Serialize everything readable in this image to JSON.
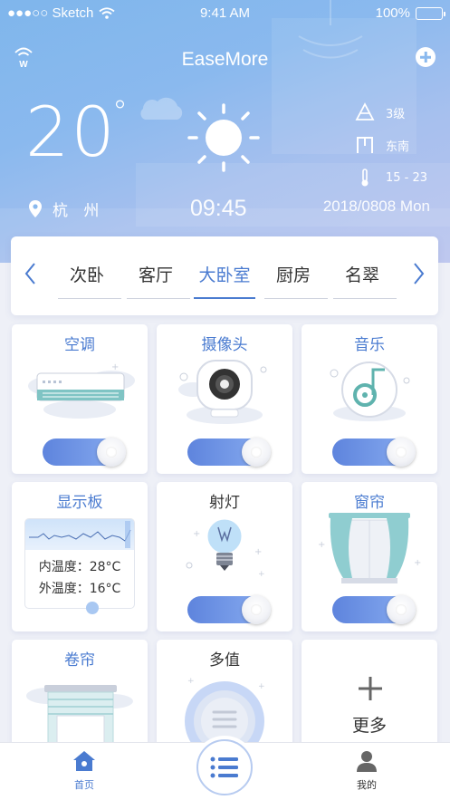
{
  "status_bar": {
    "carrier": "●●●○○ Sketch",
    "time": "9:41 AM",
    "battery": "100%"
  },
  "header": {
    "app_title": "EaseMore",
    "temperature": "20",
    "temp_unit": "°",
    "city": "杭 州",
    "clock": "09:45",
    "date": "2018/0808 Mon",
    "weather": {
      "wind_level": "3级",
      "wind_direction": "东南",
      "temp_range": "15 - 23"
    }
  },
  "rooms": {
    "tabs": [
      "次卧",
      "客厅",
      "大卧室",
      "厨房",
      "名翠"
    ],
    "active_index": 2
  },
  "devices": [
    {
      "name": "空调",
      "icon": "air-conditioner-icon",
      "toggle": true
    },
    {
      "name": "摄像头",
      "icon": "camera-icon",
      "toggle": true
    },
    {
      "name": "音乐",
      "icon": "music-icon",
      "toggle": true
    },
    {
      "name": "显示板",
      "icon": "display-board-icon",
      "inner_temp": "内温度：28°C",
      "outer_temp": "外温度：16°C"
    },
    {
      "name": "射灯",
      "icon": "spotlight-bulb-icon",
      "toggle": true
    },
    {
      "name": "窗帘",
      "icon": "curtain-icon",
      "toggle": true
    },
    {
      "name": "卷帘",
      "icon": "roller-blind-icon"
    },
    {
      "name": "多值",
      "icon": "multi-value-dial-icon"
    },
    {
      "name": "更多",
      "icon": "plus-icon"
    }
  ],
  "nav": {
    "home": "首页",
    "mine": "我的"
  },
  "colors": {
    "accent": "#4a7bd0",
    "header_gradient_start": "#7fb6ec",
    "header_gradient_end": "#b9c3ee"
  }
}
